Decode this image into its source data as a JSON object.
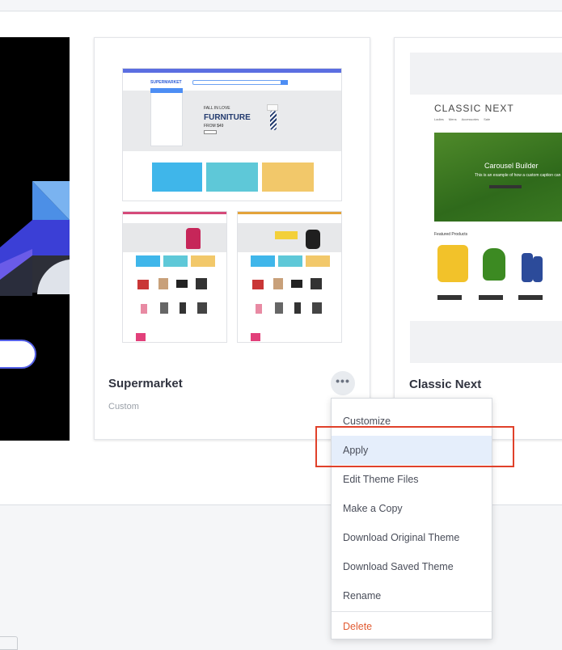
{
  "themes": [
    {
      "name": "Supermarket",
      "tag": "Custom"
    },
    {
      "name": "Classic Next"
    }
  ],
  "supermarket_preview": {
    "logo": "SUPERMARKET",
    "hero_line1": "FALL IN LOVE",
    "hero_line2": "FURNITURE",
    "hero_line3": "FROM $49"
  },
  "classic_preview": {
    "logo": "CLASSIC NEXT",
    "nav": [
      "Ladies",
      "Mens",
      "Accessories",
      "Sale"
    ],
    "carousel_title": "Carousel Builder",
    "carousel_text": "This is an example of how a custom caption can",
    "section_title": "Featured Products"
  },
  "menu": {
    "items": [
      "Customize",
      "Apply",
      "Edit Theme Files",
      "Make a Copy",
      "Download Original Theme",
      "Download Saved Theme",
      "Rename"
    ],
    "danger": "Delete"
  },
  "colors": {
    "accent": "#e0412a",
    "selection": "#e5eefb",
    "danger": "#e15b32"
  }
}
